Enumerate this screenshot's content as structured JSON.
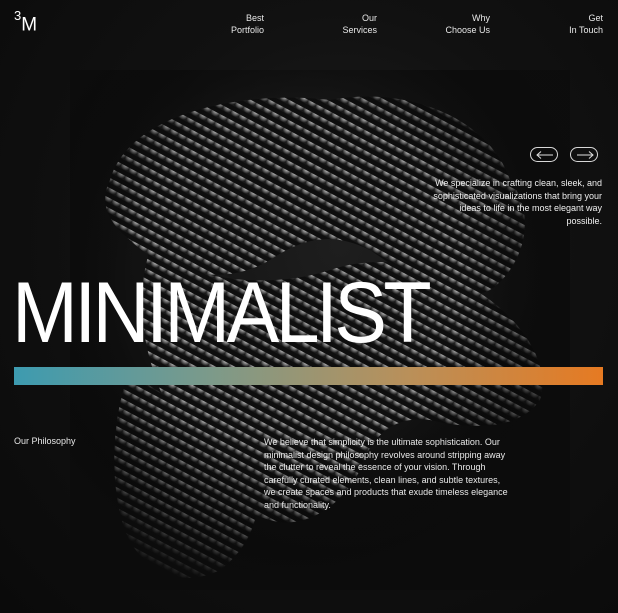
{
  "brand": {
    "logo_sup": "3",
    "logo_text": "M"
  },
  "nav": {
    "items": [
      {
        "label": "Best\nPortfolio"
      },
      {
        "label": "Our\nServices"
      },
      {
        "label": "Why\nChoose Us"
      },
      {
        "label": "Get\nIn Touch"
      }
    ]
  },
  "carousel": {
    "prev_icon": "arrow-left-icon",
    "next_icon": "arrow-right-icon"
  },
  "hero": {
    "intro": "We specialize in crafting clean, sleek, and sophisticated visualizations that bring your ideas to life in the most elegant way possible.",
    "headline": "MINIMALIST",
    "bar_colors": [
      "#3d9bb0",
      "#7c9a8a",
      "#b9905a",
      "#e67a22"
    ]
  },
  "philosophy": {
    "label": "Our Philosophy",
    "text": "We believe that simplicity is the ultimate sophistication. Our minimalist design philosophy revolves around stripping away the clutter to reveal the essence of your vision. Through carefully curated elements, clean lines, and subtle textures, we create spaces and products that exude timeless elegance and functionality."
  }
}
